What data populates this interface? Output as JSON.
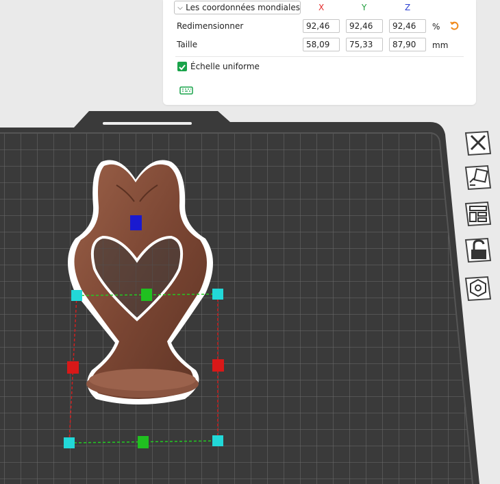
{
  "panel": {
    "coord_dropdown": "Les coordonnées mondiales",
    "axes": {
      "x": "X",
      "y": "Y",
      "z": "Z"
    },
    "axis_colors": {
      "x": "#e32b2b",
      "y": "#1f9d3c",
      "z": "#2b3fd1"
    },
    "rescale": {
      "label": "Redimensionner",
      "x": "92,46",
      "y": "92,46",
      "z": "92,46",
      "unit": "%"
    },
    "size": {
      "label": "Taille",
      "x": "58,09",
      "y": "75,33",
      "z": "87,90",
      "unit": "mm"
    },
    "uniform_scale": {
      "label": "Échelle uniforme",
      "checked": true
    },
    "icons": [
      "chevron-down-icon",
      "reset-icon",
      "keyboard-icon"
    ]
  },
  "tools": [
    "close-icon",
    "auto-orient-icon",
    "layout-icon",
    "lock-icon",
    "hexagon-icon"
  ],
  "colors": {
    "accent": "#19a34a",
    "plate": "#3b3b3b",
    "model": "#7d4a35"
  }
}
